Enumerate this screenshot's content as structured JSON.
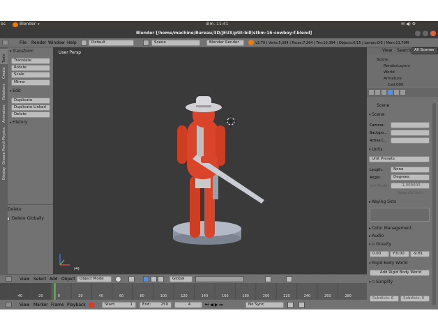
{
  "os_bar": {
    "left_label": "ès",
    "app_name": "Blender",
    "clock": "dim. 11:41"
  },
  "title_bar": {
    "title": "Blender [/home/machine/Bureau/3D/JEUX/ptit-bill/stkm-16-cowboy-f.blend]"
  },
  "menu_bar": {
    "menus": [
      "File",
      "Render",
      "Window",
      "Help"
    ],
    "layout": "Default",
    "scene": "Scene",
    "engine": "Blender Render",
    "stats": "v2.79 | Verts:5,284 | Faces:7,264 | Tris:10,394 | Objects:0/15 | Lamps:0/0 | Mem:11.79M"
  },
  "tool_shelf": {
    "tabs": [
      "Tools",
      "Create",
      "Relations",
      "Animation",
      "Physics",
      "Grease Pencil",
      "Display"
    ],
    "transform_header": "Transform",
    "transform_buttons": [
      "Translate",
      "Rotate",
      "Scale",
      "Mirror"
    ],
    "edit_header": "Edit",
    "edit_buttons": [
      "Duplicate",
      "Duplicate Linked",
      "Delete"
    ],
    "history_header": "History",
    "operator_header": "Delete",
    "operator_option": "Delete Globally"
  },
  "viewport": {
    "label": "User Persp",
    "frame_label": "(4)"
  },
  "outliner": {
    "tabs": [
      "View",
      "Search",
      "All Scenes"
    ],
    "items": [
      "Scene",
      "RenderLayers",
      "World",
      "Armature",
      "Cell.000"
    ]
  },
  "properties": {
    "context": "Scene",
    "scene_header": "Scene",
    "camera_label": "Camera:",
    "background_label": "Backgro...",
    "active_label": "Active C...",
    "units_header": "Units",
    "unit_presets": "Unit Presets",
    "length_label": "Length:",
    "length_value": "None",
    "angle_label": "Angle:",
    "angle_value": "Degrees",
    "unit_scale_label": "Unit Scale:",
    "unit_scale_value": "1.000000",
    "separate_units": "Separate Units",
    "keying_header": "Keying Sets",
    "color_mgmt_header": "Color Management",
    "audio_header": "Audio",
    "gravity_header": "Gravity",
    "gravity_x": "0.00",
    "gravity_y": "Y:0.00",
    "gravity_z": "-9.81",
    "rigid_header": "Rigid Body World",
    "rigid_button": "Add Rigid Body World",
    "simplify_header": "Simplify",
    "simplify_sub1": "Subdivis: 6",
    "simplify_sub2": "Subdivis: 6"
  },
  "view3d_header": {
    "menus": [
      "View",
      "Select",
      "Add",
      "Object"
    ],
    "mode": "Object Mode",
    "orientation": "Global"
  },
  "timeline": {
    "ticks": [
      "-40",
      "-20",
      "0",
      "20",
      "40",
      "60",
      "80",
      "100",
      "120",
      "140",
      "160",
      "180",
      "200",
      "220",
      "240",
      "260",
      "280"
    ],
    "current_frame_value": 4
  },
  "timeline_header": {
    "menus": [
      "View",
      "Marker",
      "Frame",
      "Playback"
    ],
    "start_label": "Start:",
    "start_value": "1",
    "end_label": "End:",
    "end_value": "250",
    "current": "4",
    "sync": "No Sync"
  },
  "colors": {
    "figure": "#d9442a",
    "hat": "#cfcfd4",
    "base": "#a9b0bc",
    "viewport": "#3a3a3a",
    "panel": "#727272"
  }
}
